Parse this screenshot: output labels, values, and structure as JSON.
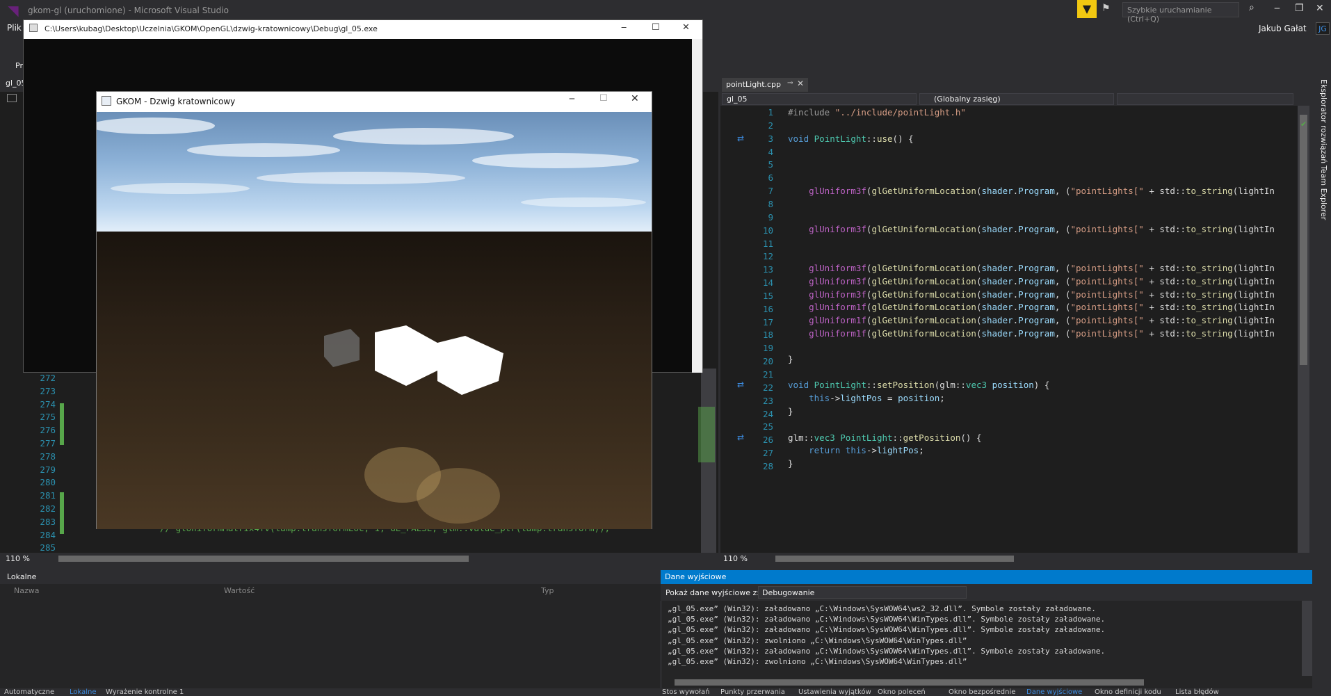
{
  "vs": {
    "title": "gkom-gl (uruchomione) - Microsoft Visual Studio",
    "quick_launch_placeholder": "Szybkie uruchamianie (Ctrl+Q)",
    "menu_first": "Plik",
    "user_name": "Jakub Gałat",
    "user_initials": "JG",
    "toolbar_fragment": "Pr"
  },
  "left_editor": {
    "tab": "gl_05",
    "zoom": "110 %",
    "line_numbers": [
      "272",
      "273",
      "274",
      "275",
      "276",
      "277",
      "278",
      "279",
      "280",
      "281",
      "282",
      "283",
      "284",
      "285"
    ],
    "visible_code": "// glUniformMatrix4fv(lamp.transformLoc, 1, GL_FALSE, glm::value_ptr(lamp.transform));"
  },
  "right_editor": {
    "tab": "pointLight.cpp",
    "nav_project": "gl_05",
    "nav_scope": "(Globalny zasięg)",
    "zoom": "110 %",
    "line_numbers": [
      "1",
      "2",
      "3",
      "4",
      "5",
      "6",
      "7",
      "8",
      "9",
      "10",
      "11",
      "12",
      "13",
      "14",
      "15",
      "16",
      "17",
      "18",
      "19",
      "20",
      "21",
      "22",
      "23",
      "24",
      "25",
      "26",
      "27",
      "28"
    ]
  },
  "side_panels": {
    "solution_explorer": "Eksplorator rozwiązań",
    "team_explorer": "Team Explorer"
  },
  "console_window": {
    "title": "C:\\Users\\kubag\\Desktop\\Uczelnia\\GKOM\\OpenGL\\dzwig-kratownicowy\\Debug\\gl_05.exe"
  },
  "gl_window": {
    "title": "GKOM - Dzwig kratownicowy"
  },
  "locals_panel": {
    "title": "Lokalne",
    "columns": [
      "Nazwa",
      "Wartość",
      "Typ"
    ]
  },
  "output_panel": {
    "title": "Dane wyjściowe",
    "show_label": "Pokaż dane wyjściowe z:",
    "source": "Debugowanie",
    "lines": [
      "„gl_05.exe” (Win32): załadowano „C:\\Windows\\SysWOW64\\ws2_32.dll”. Symbole zostały załadowane.",
      "„gl_05.exe” (Win32): załadowano „C:\\Windows\\SysWOW64\\WinTypes.dll”. Symbole zostały załadowane.",
      "„gl_05.exe” (Win32): załadowano „C:\\Windows\\SysWOW64\\WinTypes.dll”. Symbole zostały załadowane.",
      "„gl_05.exe” (Win32): zwolniono „C:\\Windows\\SysWOW64\\WinTypes.dll”",
      "„gl_05.exe” (Win32): załadowano „C:\\Windows\\SysWOW64\\WinTypes.dll”. Symbole zostały załadowane.",
      "„gl_05.exe” (Win32): zwolniono „C:\\Windows\\SysWOW64\\WinTypes.dll”"
    ]
  },
  "status_tabs": [
    "Automatyczne",
    "Lokalne",
    "Wyrażenie kontrolne 1",
    "Stos wywołań",
    "Punkty przerwania",
    "Ustawienia wyjątków",
    "Okno poleceń",
    "Okno bezpośrednie",
    "Dane wyjściowe",
    "Okno definicji kodu",
    "Lista błędów"
  ],
  "colors": {
    "accent": "#007acc",
    "filter": "#f2c811",
    "bg": "#2d2d30",
    "editor": "#1e1e1e"
  }
}
